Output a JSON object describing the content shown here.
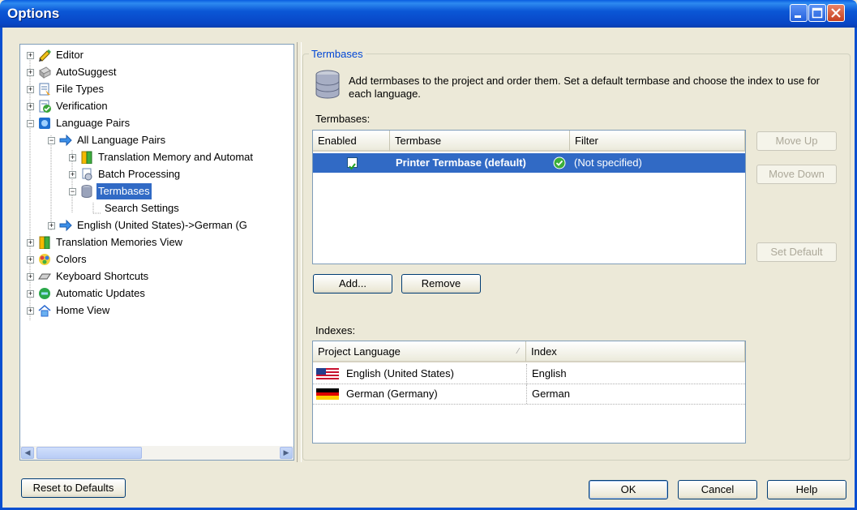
{
  "window": {
    "title": "Options"
  },
  "tree": [
    {
      "label": "Editor"
    },
    {
      "label": "AutoSuggest"
    },
    {
      "label": "File Types"
    },
    {
      "label": "Verification"
    },
    {
      "label": "Language Pairs"
    },
    {
      "label": "All Language Pairs"
    },
    {
      "label": "Translation Memory and Automat"
    },
    {
      "label": "Batch Processing"
    },
    {
      "label": "Termbases"
    },
    {
      "label": "Search Settings"
    },
    {
      "label": "English (United States)->German (G"
    },
    {
      "label": "Translation Memories View"
    },
    {
      "label": "Colors"
    },
    {
      "label": "Keyboard Shortcuts"
    },
    {
      "label": "Automatic Updates"
    },
    {
      "label": "Home View"
    }
  ],
  "panel": {
    "group_title": "Termbases",
    "description": "Add termbases to the project and order them. Set a default termbase and choose the index to use for each language.",
    "termbases_label": "Termbases:",
    "indexes_label": "Indexes:"
  },
  "termbases_table": {
    "columns": [
      "Enabled",
      "Termbase",
      "Filter"
    ],
    "rows": [
      {
        "enabled": true,
        "termbase": "Printer Termbase (default)",
        "filter": "(Not specified)"
      }
    ]
  },
  "indexes_table": {
    "columns": [
      "Project Language",
      "Index"
    ],
    "rows": [
      {
        "language": "English (United States)",
        "index": "English"
      },
      {
        "language": "German (Germany)",
        "index": "German"
      }
    ]
  },
  "buttons": {
    "move_up": "Move Up",
    "move_down": "Move Down",
    "set_default": "Set Default",
    "add": "Add...",
    "remove": "Remove",
    "reset": "Reset to Defaults",
    "ok": "OK",
    "cancel": "Cancel",
    "help": "Help"
  },
  "colors": {
    "selection": "#316ac5",
    "titlebar": "#0b57d6",
    "group_title": "#0046d5"
  }
}
